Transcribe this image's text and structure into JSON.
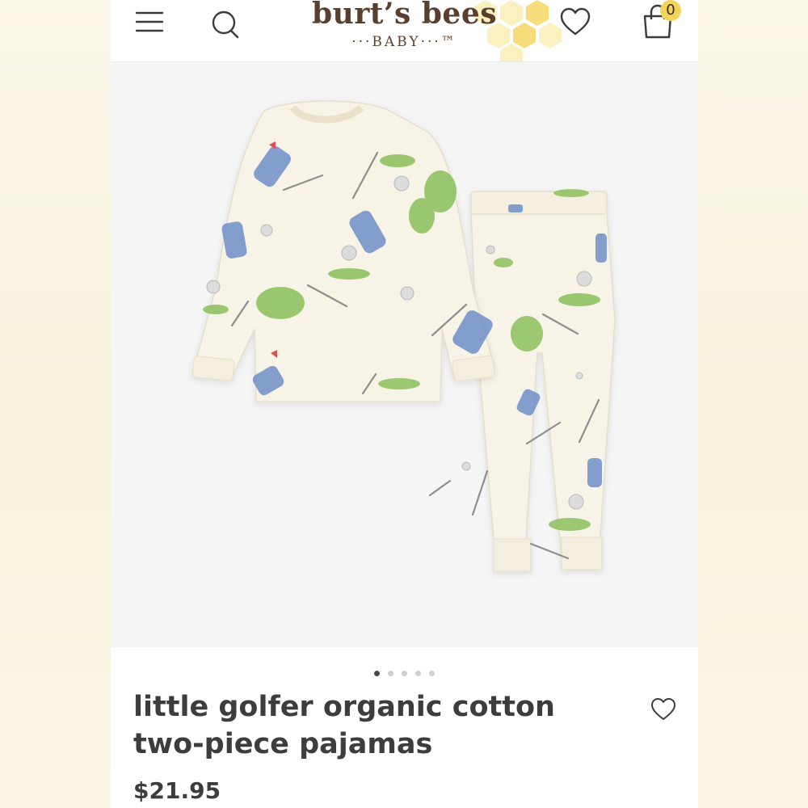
{
  "header": {
    "logo_main": "burt’s bees",
    "logo_sub": "···BABY···™",
    "cart_count": "0",
    "menu_icon": "hamburger-menu-icon",
    "search_icon": "search-icon",
    "wishlist_icon": "heart-icon",
    "cart_icon": "shopping-bag-icon"
  },
  "gallery": {
    "image_count": 5,
    "active_index": 0
  },
  "product": {
    "title_line1": "little golfer organic cotton",
    "title_line2": "two-piece pajamas",
    "price": "$21.95",
    "favorite_icon": "heart-outline-icon"
  },
  "colors": {
    "brand_brown": "#5a3f2c",
    "honey_yellow": "#f3d45a",
    "text_dark": "#3d3d3d",
    "fabric_cream": "#f7f3e6"
  }
}
